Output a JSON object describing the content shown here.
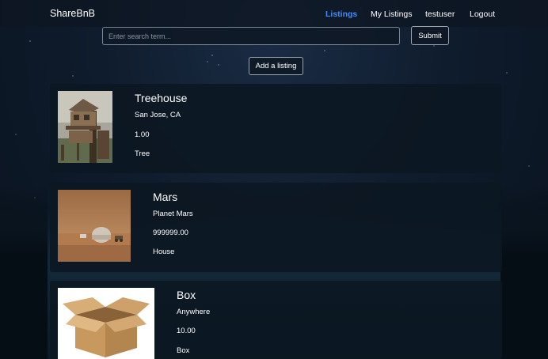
{
  "navbar": {
    "brand": "ShareBnB",
    "links": [
      {
        "label": "Listings",
        "active": true
      },
      {
        "label": "My Listings",
        "active": false
      },
      {
        "label": "testuser",
        "active": false
      },
      {
        "label": "Logout",
        "active": false
      }
    ]
  },
  "search": {
    "placeholder": "Enter search term...",
    "value": "",
    "submit_label": "Submit"
  },
  "add_listing_label": "Add a listing",
  "listings": [
    {
      "title": "Treehouse",
      "location": "San Jose, CA",
      "price": "1.00",
      "type": "Tree"
    },
    {
      "title": "Mars",
      "location": "Planet Mars",
      "price": "999999.00",
      "type": "House"
    },
    {
      "title": "Box",
      "location": "Anywhere",
      "price": "10.00",
      "type": "Box"
    }
  ],
  "colors": {
    "accent": "#3d8bfd",
    "card_bg": "#0b1721",
    "navbar_bg": "#0d1621"
  }
}
